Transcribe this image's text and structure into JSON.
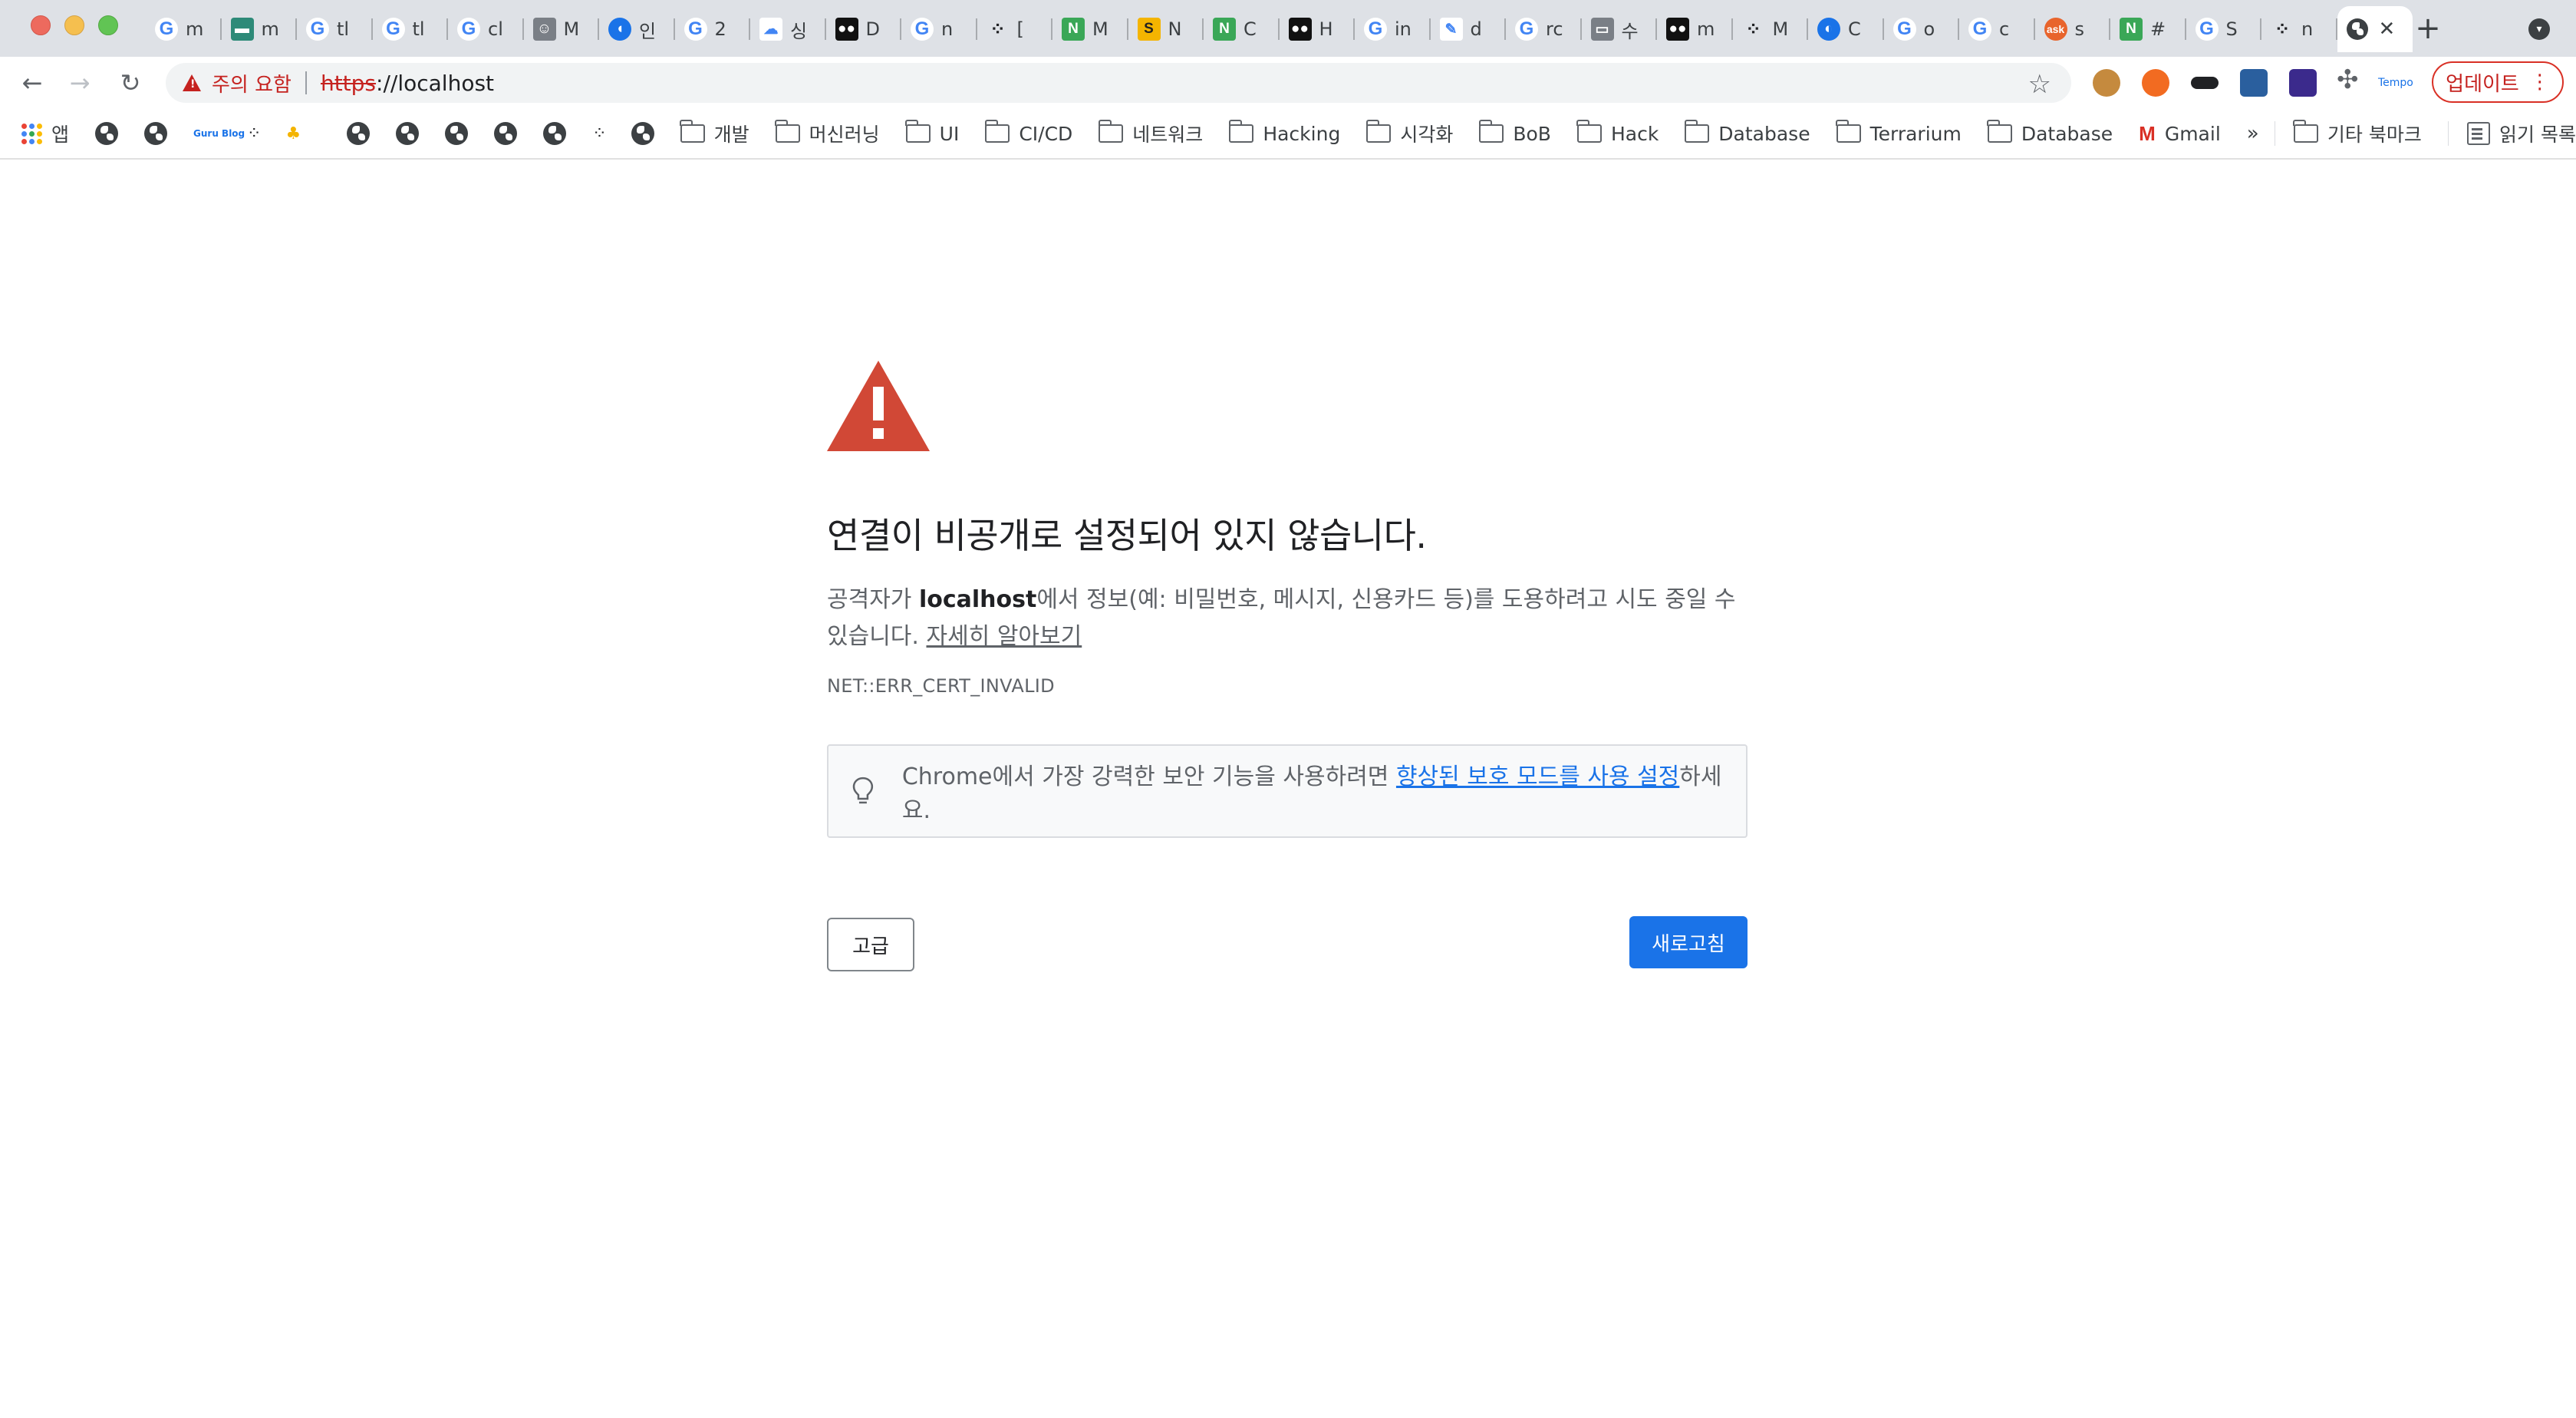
{
  "browser": {
    "tabs": [
      {
        "favicon": "G",
        "kind": "g",
        "label": "m"
      },
      {
        "favicon": "▬",
        "kind": "teal",
        "label": "m"
      },
      {
        "favicon": "G",
        "kind": "g",
        "label": "tl"
      },
      {
        "favicon": "G",
        "kind": "g",
        "label": "tl"
      },
      {
        "favicon": "G",
        "kind": "g",
        "label": "cl"
      },
      {
        "favicon": "☺",
        "kind": "gray",
        "label": "M"
      },
      {
        "favicon": "◖",
        "kind": "blue",
        "label": "인"
      },
      {
        "favicon": "G",
        "kind": "g",
        "label": "2"
      },
      {
        "favicon": "☁",
        "kind": "cloud",
        "label": "싱"
      },
      {
        "favicon": "●●",
        "kind": "dark",
        "label": "D"
      },
      {
        "favicon": "G",
        "kind": "g",
        "label": "n"
      },
      {
        "favicon": "⁘",
        "kind": "dots",
        "label": "["
      },
      {
        "favicon": "N",
        "kind": "green",
        "label": "M"
      },
      {
        "favicon": "S",
        "kind": "yellow",
        "label": "N"
      },
      {
        "favicon": "N",
        "kind": "green",
        "label": "C"
      },
      {
        "favicon": "●●",
        "kind": "dark",
        "label": "H"
      },
      {
        "favicon": "G",
        "kind": "g",
        "label": "in"
      },
      {
        "favicon": "✎",
        "kind": "cloud",
        "label": "d"
      },
      {
        "favicon": "G",
        "kind": "g",
        "label": "rc"
      },
      {
        "favicon": "▭",
        "kind": "gray",
        "label": "수"
      },
      {
        "favicon": "●●",
        "kind": "dark",
        "label": "m"
      },
      {
        "favicon": "⁘",
        "kind": "dots",
        "label": "M"
      },
      {
        "favicon": "◐",
        "kind": "blue",
        "label": "C"
      },
      {
        "favicon": "G",
        "kind": "g",
        "label": "o"
      },
      {
        "favicon": "G",
        "kind": "g",
        "label": "c"
      },
      {
        "favicon": "ask",
        "kind": "orange",
        "label": "s"
      },
      {
        "favicon": "N",
        "kind": "green",
        "label": "#"
      },
      {
        "favicon": "G",
        "kind": "g",
        "label": "S"
      },
      {
        "favicon": "⁘",
        "kind": "dots",
        "label": "n"
      }
    ],
    "active_tab_close": "✕",
    "new_tab": "+",
    "tab_search": "▾"
  },
  "toolbar": {
    "back": "←",
    "forward": "→",
    "reload": "↻",
    "security_warning": "주의 요함",
    "url_scheme": "https",
    "url_rest": "://localhost",
    "star": "☆",
    "puzzle": "✣",
    "tempo_label": "Tempo",
    "update_label": "업데이트",
    "update_menu": "⋮"
  },
  "bookmarks": {
    "apps_label": "앱",
    "guru_label": "Guru Blog",
    "folders": [
      "개발",
      "머신러닝",
      "UI",
      "CI/CD",
      "네트워크",
      "Hacking",
      "시각화",
      "BoB",
      "Hack",
      "Database",
      "Terrarium",
      "Database"
    ],
    "gmail_label": "Gmail",
    "more": "»",
    "other_bookmarks": "기타 북마크",
    "reading_list": "읽기 목록"
  },
  "interstitial": {
    "heading": "연결이 비공개로 설정되어 있지 않습니다.",
    "desc_prefix": "공격자가 ",
    "desc_host": "localhost",
    "desc_suffix": "에서 정보(예: 비밀번호, 메시지, 신용카드 등)를 도용하려고 시도 중일 수 있습니다.",
    "learn_more": "자세히 알아보기",
    "error_code": "NET::ERR_CERT_INVALID",
    "tip_prefix": "Chrome에서 가장 강력한 보안 기능을 사용하려면 ",
    "tip_link": "향상된 보호 모드를 사용 설정",
    "tip_suffix": "하세요.",
    "advanced_button": "고급",
    "reload_button": "새로고침"
  },
  "colors": {
    "warning_red": "#d14836",
    "link_blue": "#1a73e8",
    "primary_button": "#1a73e8"
  }
}
